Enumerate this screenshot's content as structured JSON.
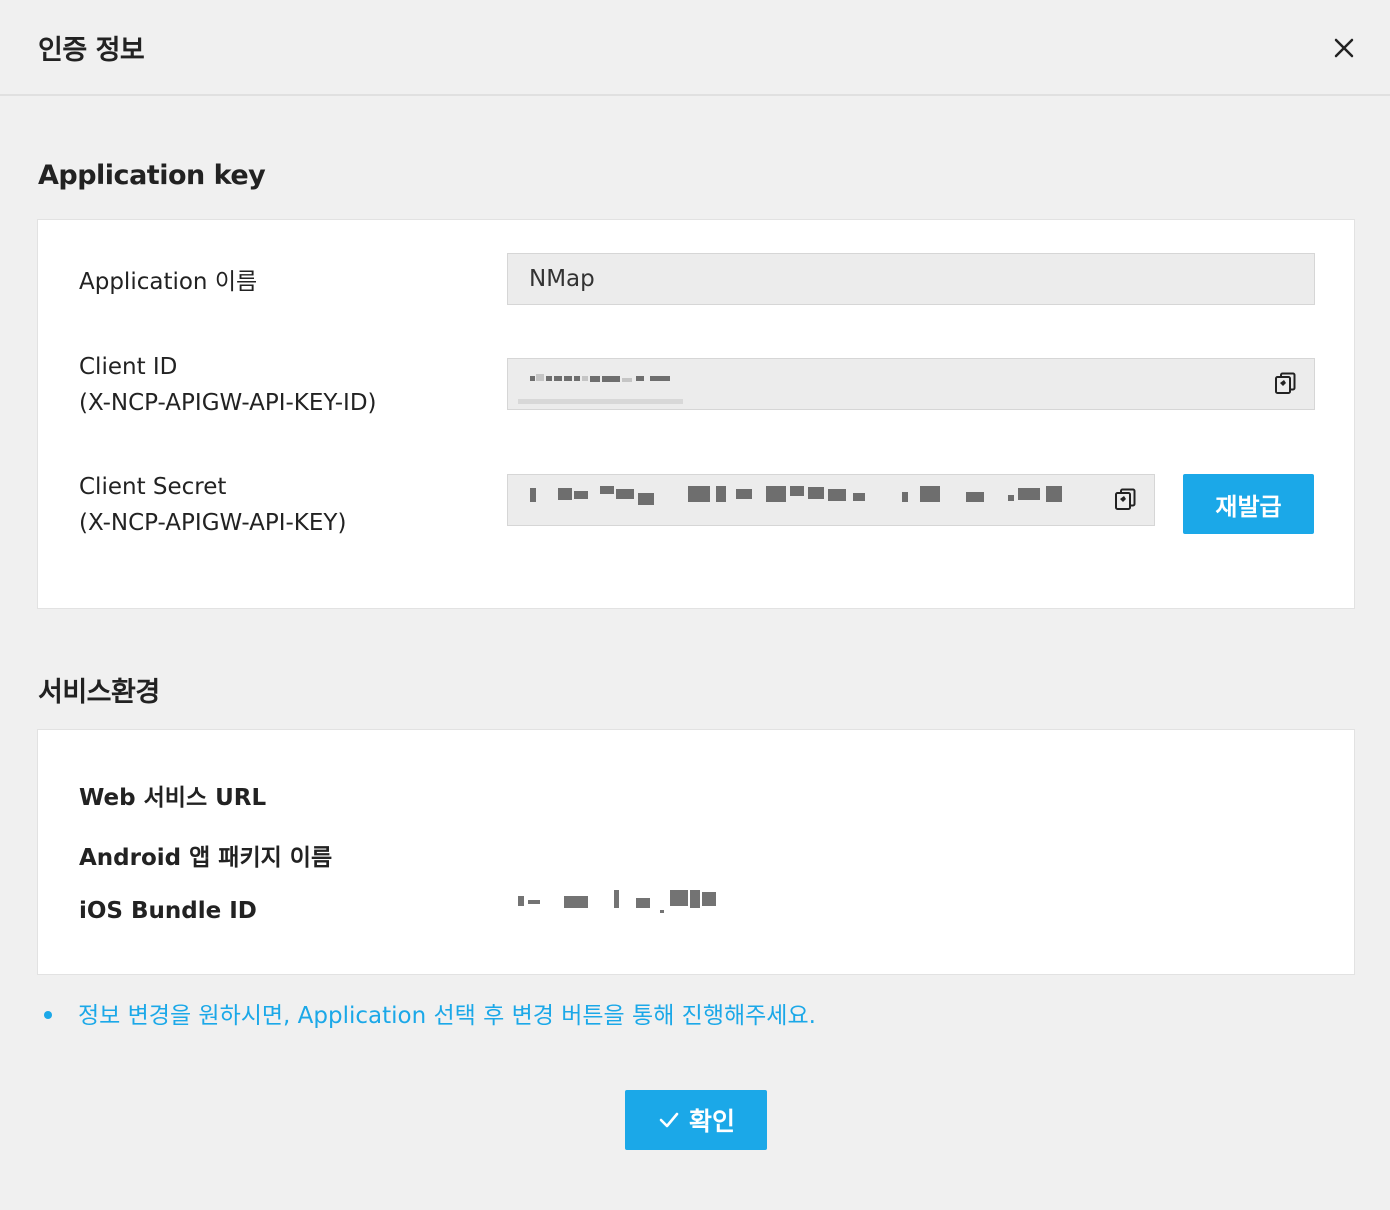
{
  "dialog": {
    "title": "인증 정보"
  },
  "application_key": {
    "section_title": "Application key",
    "app_name_label": "Application 이름",
    "app_name_value": "NMap",
    "client_id_label_line1": "Client ID",
    "client_id_label_line2": "(X-NCP-APIGW-API-KEY-ID)",
    "client_secret_label_line1": "Client Secret",
    "client_secret_label_line2": "(X-NCP-APIGW-API-KEY)",
    "reissue_label": "재발급"
  },
  "service_env": {
    "section_title": "서비스환경",
    "web_url_label": "Web 서비스 URL",
    "android_label": "Android 앱 패키지 이름",
    "ios_label": "iOS Bundle ID"
  },
  "notice": {
    "text": "정보 변경을 원하시면, Application 선택 후 변경 버튼을 통해 진행해주세요."
  },
  "footer": {
    "confirm_label": "확인"
  },
  "colors": {
    "accent": "#1ba8e8",
    "background": "#f0f0f0",
    "panel": "#ffffff",
    "field_bg": "#ececec"
  },
  "icons": [
    "close-icon",
    "copy-icon",
    "check-icon"
  ]
}
